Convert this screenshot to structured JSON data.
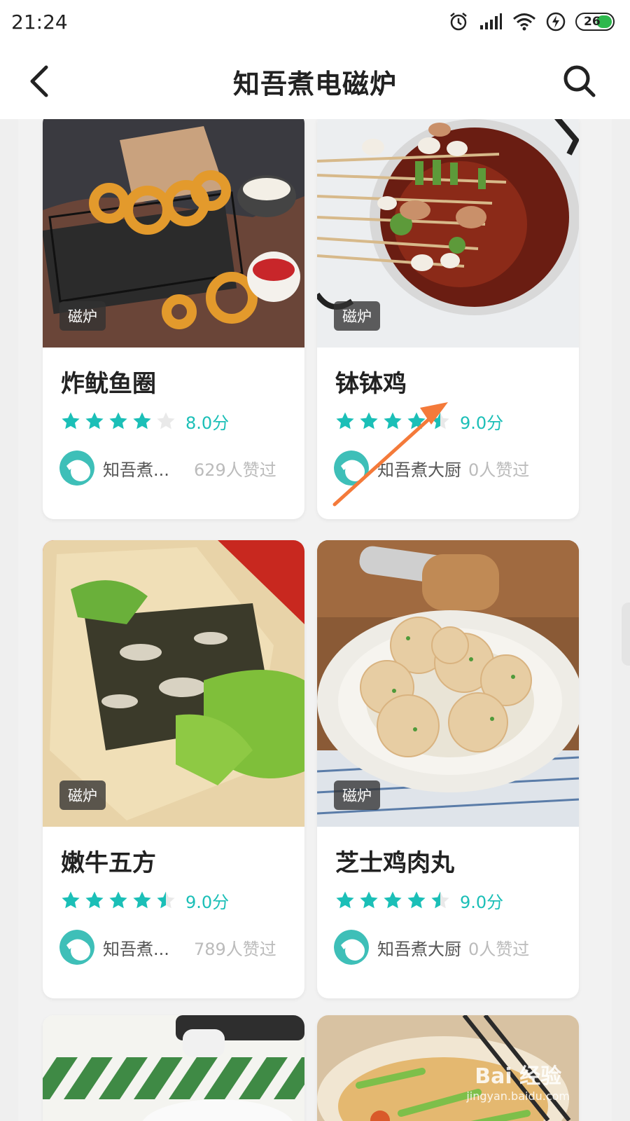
{
  "status_bar": {
    "time": "21:24",
    "battery": "26"
  },
  "nav": {
    "title": "知吾煮电磁炉"
  },
  "colors": {
    "accent": "#1bbfb7",
    "arrow": "#f47a3a"
  },
  "cards": [
    {
      "title": "炸鱿鱼圈",
      "tag": "磁炉",
      "score": "8.0分",
      "stars": 4,
      "author": "知吾煮...",
      "likes": "629人赞过"
    },
    {
      "title": "钵钵鸡",
      "tag": "磁炉",
      "score": "9.0分",
      "stars": 4.5,
      "author": "知吾煮大厨",
      "likes": "0人赞过"
    },
    {
      "title": "嫩牛五方",
      "tag": "磁炉",
      "score": "9.0分",
      "stars": 4.5,
      "author": "知吾煮...",
      "likes": "789人赞过"
    },
    {
      "title": "芝士鸡肉丸",
      "tag": "磁炉",
      "score": "9.0分",
      "stars": 4.5,
      "author": "知吾煮大厨",
      "likes": "0人赞过"
    }
  ],
  "watermark": {
    "brand": "Bai 经验",
    "url": "jingyan.baidu.com"
  }
}
